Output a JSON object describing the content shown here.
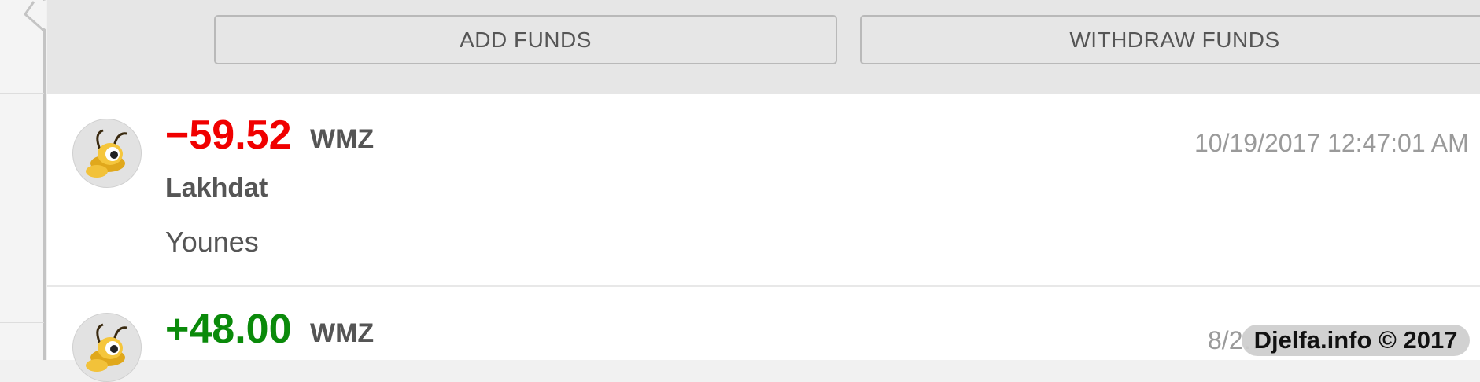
{
  "toolbar": {
    "add_funds_label": "ADD FUNDS",
    "withdraw_funds_label": "WITHDRAW FUNDS"
  },
  "transactions": [
    {
      "amount": "−59.52",
      "currency": "WMZ",
      "datetime": "10/19/2017 12:47:01 AM",
      "name": "Lakhdat",
      "description": "Younes",
      "amount_color": "#f00000",
      "avatar_icon": "ant-mascot-icon"
    },
    {
      "amount": "+48.00",
      "currency": "WMZ",
      "datetime": "8/2…",
      "amount_color": "#0a8a0a",
      "avatar_icon": "ant-mascot-icon"
    }
  ],
  "watermark": "Djelfa.info © 2017",
  "colors": {
    "negative": "#f00000",
    "positive": "#0a8a0a",
    "toolbar_bg": "#e6e6e6"
  }
}
